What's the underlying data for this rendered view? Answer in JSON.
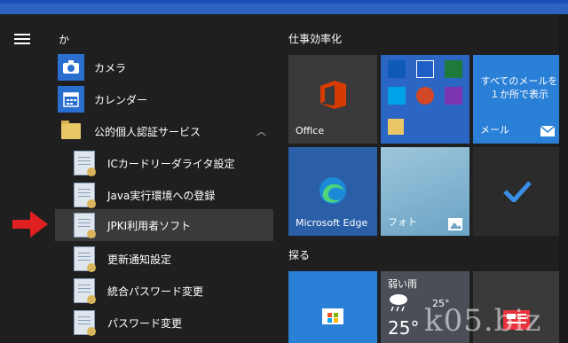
{
  "start_menu": {
    "section_letter": "か",
    "apps": [
      {
        "label": "カメラ",
        "icon": "camera-icon"
      },
      {
        "label": "カレンダー",
        "icon": "calendar-icon"
      },
      {
        "label": "公的個人認証サービス",
        "icon": "folder-icon",
        "expanded": true
      }
    ],
    "folder_items": [
      {
        "label": "ICカードリーダライタ設定"
      },
      {
        "label": "Java実行環境への登録"
      },
      {
        "label": "JPKI利用者ソフト"
      },
      {
        "label": "更新通知設定"
      },
      {
        "label": "統合パスワード変更"
      },
      {
        "label": "パスワード変更"
      }
    ]
  },
  "tiles": {
    "group1": "仕事効率化",
    "group2": "探る",
    "office": "Office",
    "mail_text": "すべてのメールを１か所で表示",
    "mail": "メール",
    "edge": "Microsoft Edge",
    "photos": "フォト",
    "weather_title": "弱い雨",
    "weather_temp": "25°",
    "weather_temp2": "25°"
  },
  "watermark": "k05.biz",
  "colors": {
    "accent": "#2a6fd0",
    "highlight_row": "#3a3a3a",
    "arrow": "#e02020",
    "office_red": "#d83b01"
  }
}
